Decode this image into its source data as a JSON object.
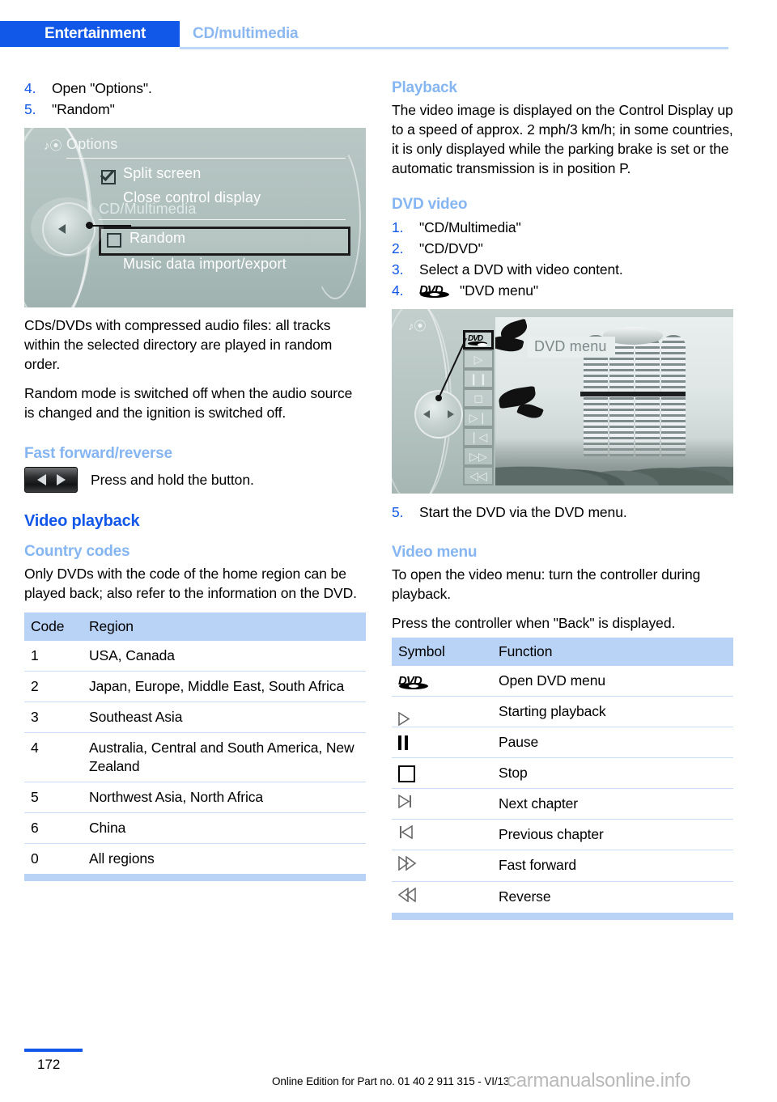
{
  "header": {
    "tab_label": "Entertainment",
    "section_label": "CD/multimedia",
    "tab_bg": "#1157e8",
    "section_color": "#8cb8f2"
  },
  "left_column": {
    "steps_top": [
      {
        "num": "4.",
        "text": "Open \"Options\"."
      },
      {
        "num": "5.",
        "text": "\"Random\""
      }
    ],
    "idrive_screenshot": {
      "title": "Options",
      "title_icon": "cd-multimedia-icon",
      "items": [
        {
          "label": "Split screen",
          "checkbox": "checked"
        },
        {
          "label": "Close control display",
          "checkbox": "none"
        },
        {
          "label": "CD/Multimedia",
          "checkbox": "none",
          "dim": true
        },
        {
          "label": "Random",
          "checkbox": "unchecked",
          "selected": true
        },
        {
          "label": "Music data import/export",
          "checkbox": "none"
        }
      ]
    },
    "paragraphs": [
      "CDs/DVDs with compressed audio files: all tracks within the selected directory are played in random order.",
      "Random mode is switched off when the audio source is changed and the ignition is switched off."
    ],
    "fast_forward": {
      "heading": "Fast forward/reverse",
      "note": "Press and hold the button.",
      "button_icon": "fast-forward-reverse-rocker-button"
    },
    "video_playback_heading": "Video playback",
    "country_codes": {
      "heading": "Country codes",
      "intro": "Only DVDs with the code of the home region can be played back; also refer to the information on the DVD.",
      "columns": [
        "Code",
        "Region"
      ],
      "rows": [
        [
          "1",
          "USA, Canada"
        ],
        [
          "2",
          "Japan, Europe, Middle East, South Africa"
        ],
        [
          "3",
          "Southeast Asia"
        ],
        [
          "4",
          "Australia, Central and South America, New Zealand"
        ],
        [
          "5",
          "Northwest Asia, North Africa"
        ],
        [
          "6",
          "China"
        ],
        [
          "0",
          "All regions"
        ]
      ]
    }
  },
  "right_column": {
    "playback": {
      "heading": "Playback",
      "text": "The video image is displayed on the Control Display up to a speed of approx. 2 mph/3 km/h; in some countries, it is only displayed while the parking brake is set or the automatic transmission is in position P."
    },
    "dvd_video": {
      "heading": "DVD video",
      "steps": [
        {
          "num": "1.",
          "text": "\"CD/Multimedia\""
        },
        {
          "num": "2.",
          "text": "\"CD/DVD\""
        },
        {
          "num": "3.",
          "text": "Select a DVD with video content."
        },
        {
          "num": "4.",
          "text": "\"DVD menu\"",
          "icon": "dvd-logo-icon"
        }
      ]
    },
    "dvd_screenshot": {
      "overlay_label": "DVD menu",
      "buttons": [
        "dvd-menu-icon",
        "play-icon",
        "pause-icon",
        "stop-icon",
        "next-chapter-icon",
        "previous-chapter-icon",
        "fast-forward-icon",
        "reverse-icon"
      ],
      "image_subject": "bmw-tower-photo"
    },
    "step_after_screenshot": {
      "num": "5.",
      "text": "Start the DVD via the DVD menu."
    },
    "video_menu": {
      "heading": "Video menu",
      "paragraphs": [
        "To open the video menu: turn the controller during playback.",
        "Press the controller when \"Back\" is displayed."
      ],
      "columns": [
        "Symbol",
        "Function"
      ],
      "rows": [
        {
          "symbol": "dvd-logo-icon",
          "function": "Open DVD menu"
        },
        {
          "symbol": "play-icon",
          "function": "Starting playback"
        },
        {
          "symbol": "pause-icon",
          "function": "Pause"
        },
        {
          "symbol": "stop-icon",
          "function": "Stop"
        },
        {
          "symbol": "next-chapter-icon",
          "function": "Next chapter"
        },
        {
          "symbol": "previous-chapter-icon",
          "function": "Previous chapter"
        },
        {
          "symbol": "fast-forward-icon",
          "function": "Fast forward"
        },
        {
          "symbol": "reverse-icon",
          "function": "Reverse"
        }
      ]
    }
  },
  "footer": {
    "page_number": "172",
    "edition_line": "Online Edition for Part no. 01 40 2 911 315 - VI/13",
    "watermark": "carmanualsonline.info"
  }
}
